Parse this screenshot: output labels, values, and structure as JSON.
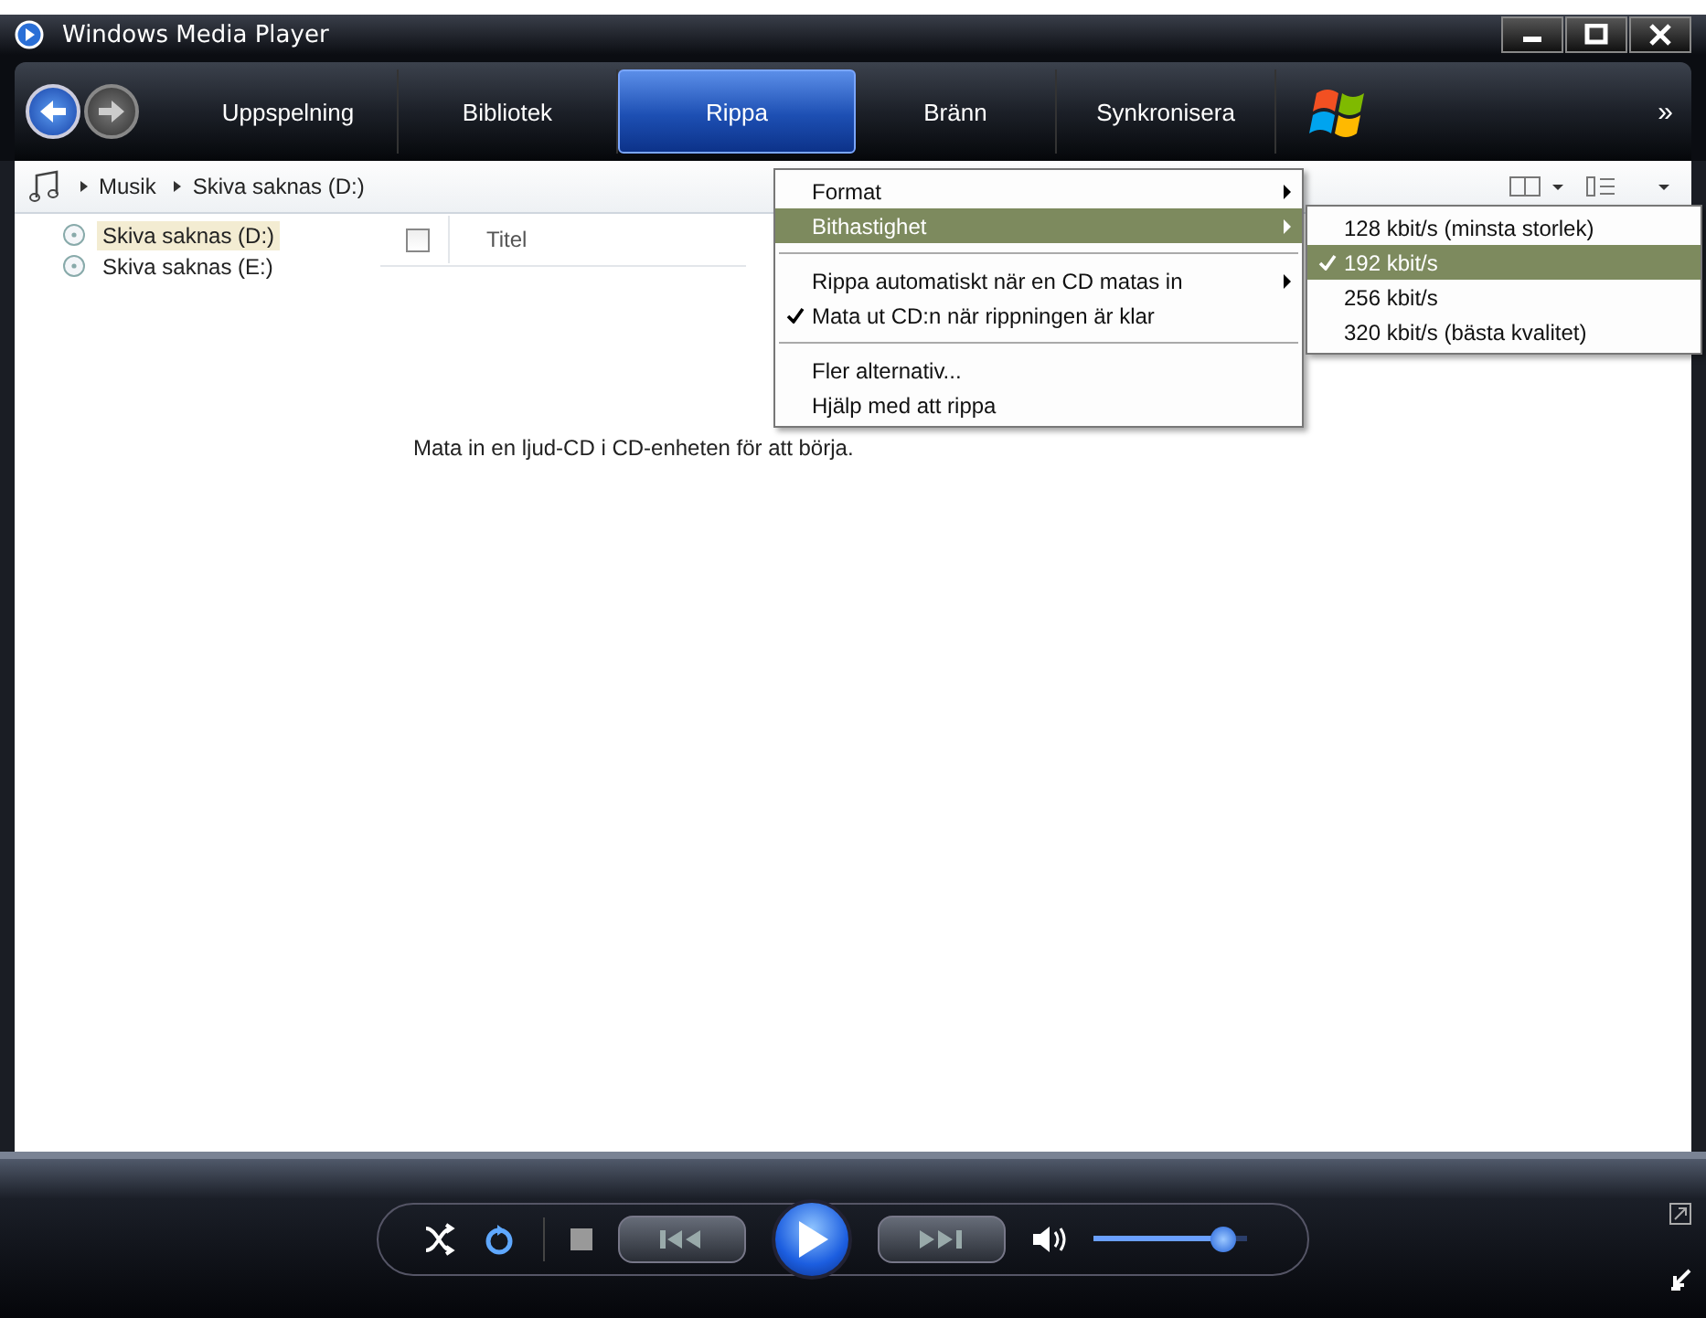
{
  "window": {
    "title": "Windows Media Player"
  },
  "tabs": [
    {
      "label": "Uppspelning",
      "selected": false
    },
    {
      "label": "Bibliotek",
      "selected": false
    },
    {
      "label": "Rippa",
      "selected": true
    },
    {
      "label": "Bränn",
      "selected": false
    },
    {
      "label": "Synkronisera",
      "selected": false
    }
  ],
  "more_button": "»",
  "breadcrumb": [
    "Musik",
    "Skiva saknas (D:)"
  ],
  "sidebar": {
    "items": [
      {
        "label": "Skiva saknas (D:)",
        "selected": true
      },
      {
        "label": "Skiva saknas (E:)",
        "selected": false
      }
    ]
  },
  "table": {
    "select_all_checked": false,
    "columns": [
      "Titel"
    ]
  },
  "message": "Mata in en ljud-CD i CD-enheten för att börja.",
  "menu": {
    "items": [
      {
        "kind": "item",
        "label": "Format",
        "submenu": true,
        "checked": false,
        "selected": false
      },
      {
        "kind": "item",
        "label": "Bithastighet",
        "submenu": true,
        "checked": false,
        "selected": true
      },
      {
        "kind": "separator"
      },
      {
        "kind": "item",
        "label": "Rippa automatiskt när en CD matas in",
        "submenu": true,
        "checked": false,
        "selected": false
      },
      {
        "kind": "item",
        "label": "Mata ut CD:n när rippningen är klar",
        "submenu": false,
        "checked": true,
        "selected": false
      },
      {
        "kind": "separator"
      },
      {
        "kind": "item",
        "label": "Fler alternativ...",
        "submenu": false,
        "checked": false,
        "selected": false
      },
      {
        "kind": "item",
        "label": "Hjälp med att rippa",
        "submenu": false,
        "checked": false,
        "selected": false
      }
    ]
  },
  "submenu": {
    "items": [
      {
        "label": "128 kbit/s (minsta storlek)",
        "checked": false,
        "selected": false
      },
      {
        "label": "192 kbit/s",
        "checked": true,
        "selected": true
      },
      {
        "label": "256 kbit/s",
        "checked": false,
        "selected": false
      },
      {
        "label": "320 kbit/s (bästa kvalitet)",
        "checked": false,
        "selected": false
      }
    ]
  },
  "controls": {
    "shuffle_on": false,
    "repeat_on": true,
    "volume": {
      "level": 0.85
    }
  }
}
